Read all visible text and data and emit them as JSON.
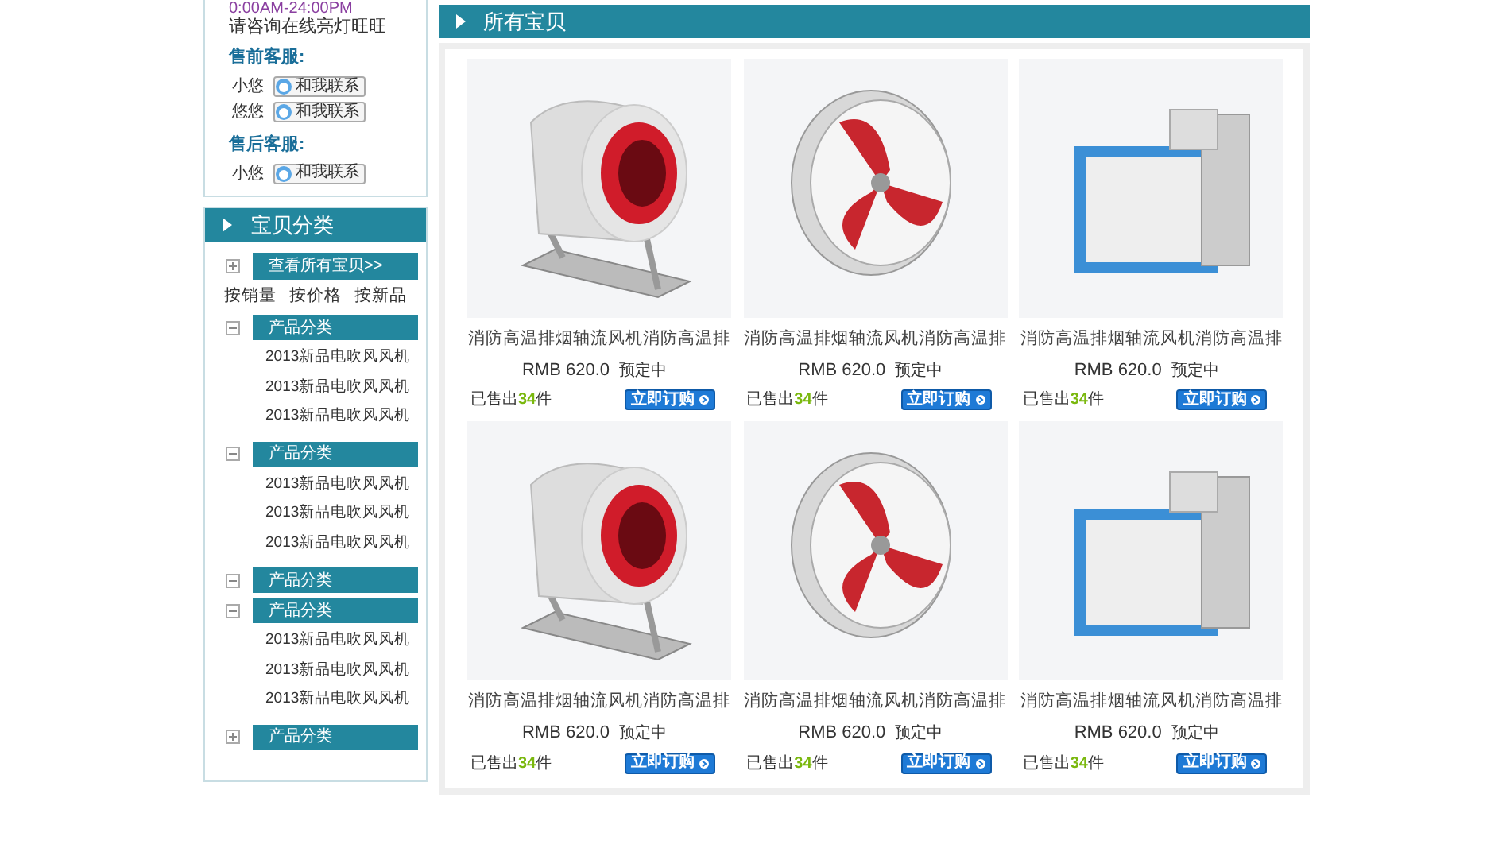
{
  "sidebar": {
    "hours": "0:00AM-24:00PM",
    "hint": "请咨询在线亮灯旺旺",
    "service_groups": [
      {
        "title": "售前客服:",
        "agents": [
          {
            "name": "小悠",
            "button": "和我联系"
          },
          {
            "name": "悠悠",
            "button": "和我联系"
          }
        ]
      },
      {
        "title": "售后客服:",
        "agents": [
          {
            "name": "小悠",
            "button": "和我联系"
          }
        ]
      }
    ],
    "category_title": "宝贝分类",
    "view_all": {
      "label": "查看所有宝贝>>",
      "expanded": false
    },
    "sort_links": [
      "按销量",
      "按价格",
      "按新品"
    ],
    "groups": [
      {
        "label": "产品分类",
        "expanded": true,
        "children": [
          "2013新品电吹风风机",
          "2013新品电吹风风机",
          "2013新品电吹风风机"
        ]
      },
      {
        "label": "产品分类",
        "expanded": true,
        "children": [
          "2013新品电吹风风机",
          "2013新品电吹风风机",
          "2013新品电吹风风机"
        ]
      },
      {
        "label": "产品分类",
        "expanded": true
      },
      {
        "label": "产品分类",
        "expanded": true,
        "children": [
          "2013新品电吹风风机",
          "2013新品电吹风风机",
          "2013新品电吹风风机"
        ]
      },
      {
        "label": "产品分类",
        "expanded": false
      }
    ]
  },
  "main": {
    "title": "所有宝贝",
    "products": [
      {
        "kind": "centrifugal",
        "title": "消防高温排烟轴流风机消防高温排",
        "price": "RMB 620.0",
        "status": "预定中",
        "sold_prefix": "已售出",
        "sold_count": "34",
        "sold_suffix": "件",
        "button": "立即订购"
      },
      {
        "kind": "axial",
        "title": "消防高温排烟轴流风机消防高温排",
        "price": "RMB 620.0",
        "status": "预定中",
        "sold_prefix": "已售出",
        "sold_count": "34",
        "sold_suffix": "件",
        "button": "立即订购"
      },
      {
        "kind": "cabinet",
        "title": "消防高温排烟轴流风机消防高温排",
        "price": "RMB 620.0",
        "status": "预定中",
        "sold_prefix": "已售出",
        "sold_count": "34",
        "sold_suffix": "件",
        "button": "立即订购"
      },
      {
        "kind": "centrifugal",
        "title": "消防高温排烟轴流风机消防高温排",
        "price": "RMB 620.0",
        "status": "预定中",
        "sold_prefix": "已售出",
        "sold_count": "34",
        "sold_suffix": "件",
        "button": "立即订购"
      },
      {
        "kind": "axial",
        "title": "消防高温排烟轴流风机消防高温排",
        "price": "RMB 620.0",
        "status": "预定中",
        "sold_prefix": "已售出",
        "sold_count": "34",
        "sold_suffix": "件",
        "button": "立即订购"
      },
      {
        "kind": "cabinet",
        "title": "消防高温排烟轴流风机消防高温排",
        "price": "RMB 620.0",
        "status": "预定中",
        "sold_prefix": "已售出",
        "sold_count": "34",
        "sold_suffix": "件",
        "button": "立即订购"
      }
    ]
  }
}
